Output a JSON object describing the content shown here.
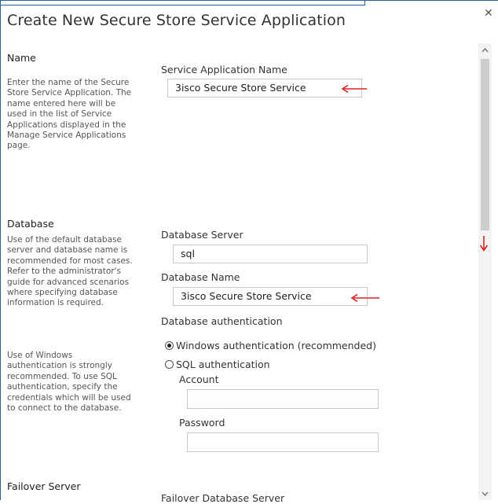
{
  "dialog": {
    "title": "Create New Secure Store Service Application",
    "close_glyph": "✕"
  },
  "sections": {
    "name": {
      "title": "Name",
      "description": "Enter the name of the Secure Store Service Application. The name entered here will be used in the list of Service Applications displayed in the Manage Service Applications page."
    },
    "database": {
      "title": "Database",
      "description": "Use of the default database server and database name is recommended for most cases. Refer to the administrator's guide for advanced scenarios where specifying database information is required.",
      "description2": "Use of Windows authentication is strongly recommended. To use SQL authentication, specify the credentials which will be used to connect to the database."
    },
    "failover": {
      "title": "Failover Server"
    }
  },
  "fields": {
    "service_app_name": {
      "label": "Service Application Name",
      "value": "3isco Secure Store Service"
    },
    "db_server": {
      "label": "Database Server",
      "value": "sql"
    },
    "db_name": {
      "label": "Database Name",
      "value": "3isco Secure Store Service"
    },
    "db_auth": {
      "label": "Database authentication"
    },
    "windows_auth": {
      "label": "Windows authentication (recommended)",
      "checked": true
    },
    "sql_auth": {
      "label": "SQL authentication",
      "checked": false
    },
    "account": {
      "label": "Account",
      "value": ""
    },
    "password": {
      "label": "Password",
      "value": ""
    },
    "failover_db_server": {
      "label": "Failover Database Server"
    }
  },
  "icons": {
    "close": "close-icon",
    "arrow": "red-arrow-icon",
    "scroll_up": "chevron-up-icon",
    "scroll_down": "chevron-down-icon"
  },
  "colors": {
    "frame_border": "#2a5da8",
    "annotation_red": "#e02020"
  }
}
